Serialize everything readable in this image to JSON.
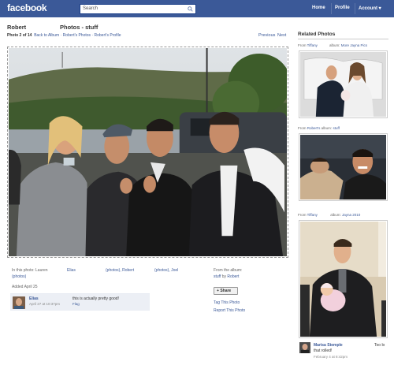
{
  "topbar": {
    "logo": "facebook",
    "search_placeholder": "Search",
    "nav": [
      "Home",
      "Profile",
      "Account ▾"
    ],
    "color": "#3b5998"
  },
  "header": {
    "owner": "Robert",
    "album_title": "Photos - stuff",
    "photo_count": "Photo 2 of 14",
    "back_link": "Back to Album",
    "crumb1": "Robert's Photos",
    "crumb2": "Robert's Profile",
    "prev": "Previous",
    "next": "Next"
  },
  "photo_info": {
    "in_photo_label": "In this photo: Lauren",
    "person1": "Elias",
    "robert_photos": "(photos), Robert",
    "joel_photos": "(photos), Joel",
    "photos_paren": "(photos)",
    "added": "Added April 25",
    "from_album_label": "From the album:",
    "album_name": "stuff",
    "by": "by",
    "album_owner": "Robert",
    "share": "Share",
    "tag_photo": "Tag This Photo",
    "report_photo": "Report This Photo"
  },
  "comment": {
    "author": "Elias",
    "time": "April 27 at 10:37pm",
    "text": "this is actually pretty good!",
    "flag": "Flag"
  },
  "related": {
    "title": "Related Photos",
    "items": [
      {
        "from_label": "From",
        "from": "Tiffany",
        "album_label": "album:",
        "album": "More Jayna Pics"
      },
      {
        "from_label": "From",
        "from": "Robert's",
        "album_label": "album:",
        "album": "stuff"
      },
      {
        "from_label": "From",
        "from": "Tiffany",
        "album_label": "album:",
        "album": "Jayna 2010"
      }
    ]
  },
  "related_comment": {
    "author": "Marisa Stemple",
    "text": "that rolled!",
    "suffix": "Too lo",
    "time": "February 4 at 8:42pm"
  }
}
